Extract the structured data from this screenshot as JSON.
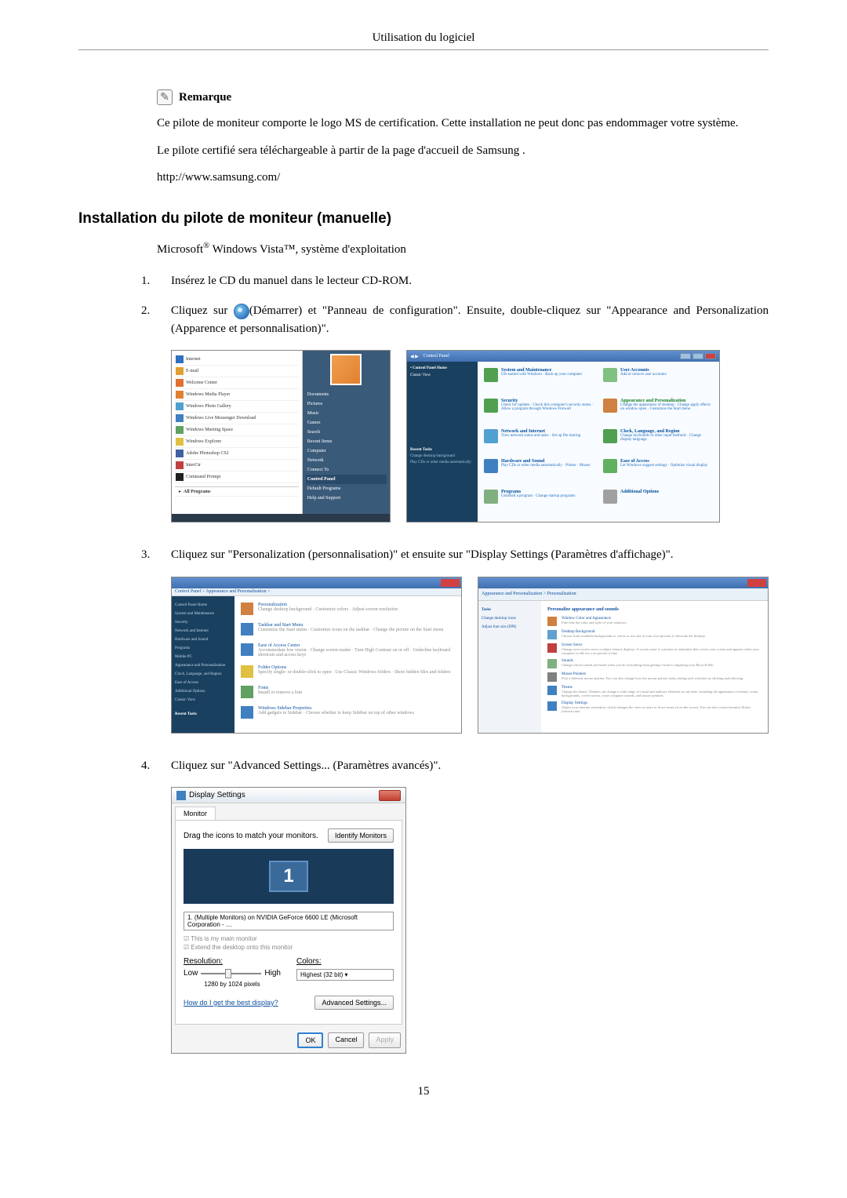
{
  "header": "Utilisation du logiciel",
  "note": {
    "title": "Remarque",
    "p1": "Ce pilote de moniteur comporte le logo MS de certification. Cette installation ne peut donc pas endommager votre système.",
    "p2": "Le pilote certifié sera téléchargeable à partir de la page d'accueil de Samsung .",
    "url": "http://www.samsung.com/"
  },
  "section_title": "Installation du pilote de moniteur (manuelle)",
  "subtitle_prefix": "Microsoft",
  "subtitle_mid": " Windows Vista™",
  "subtitle_suffix": ", système d'exploitation",
  "steps": {
    "1": "Insérez le CD du manuel dans le lecteur CD-ROM.",
    "2a": "Cliquez sur ",
    "2b": "(Démarrer) et \"Panneau de configuration\". Ensuite, double-cliquez sur \"Appearance and Personalization (Apparence et personnalisation)\".",
    "3": "Cliquez sur \"Personalization (personnalisation)\" et ensuite sur \"Display Settings (Paramètres d'affichage)\".",
    "4": "Cliquez sur \"Advanced Settings... (Paramètres avancés)\"."
  },
  "startmenu": {
    "items": [
      "Internet",
      "E-mail",
      "Welcome Center",
      "Windows Media Player",
      "Windows Photo Gallery",
      "Windows Live Messenger Download",
      "Windows Meeting Space",
      "Windows Explorer",
      "Adobe Photoshop CS2",
      "InterCtr",
      "Command Prompt",
      "All Programs"
    ],
    "right": [
      "Documents",
      "Pictures",
      "Music",
      "Games",
      "Search",
      "Recent Items",
      "Computer",
      "Network",
      "Connect To",
      "Control Panel",
      "Default Programs",
      "Help and Support"
    ]
  },
  "controlpanel": {
    "addr": "Control Panel",
    "sidebar": [
      "Control Panel Home",
      "Classic View"
    ],
    "recent": "Recent Tasks",
    "recent_items": [
      "Change desktop background",
      "Play CDs or other media automatically"
    ],
    "cats": [
      {
        "title": "System and Maintenance",
        "sub": "Get started with Windows · Back up your computer",
        "color": "#50a050"
      },
      {
        "title": "User Accounts",
        "sub": "Add or remove user accounts",
        "color": "#80c080"
      },
      {
        "title": "Security",
        "sub": "Check for updates · Check this computer's security status · Allow a program through Windows Firewall",
        "color": "#50a050"
      },
      {
        "title": "Appearance and Personalization",
        "sub": "Change the appearance of desktop · Change apply effects on window open · Customize the Start menu",
        "color": "#d08040",
        "hl": true
      },
      {
        "title": "Network and Internet",
        "sub": "View network status and tasks · Set up file sharing",
        "color": "#50a0d0"
      },
      {
        "title": "Clock, Language, and Region",
        "sub": "Change keyboards or other input methods · Change display language",
        "color": "#50a050"
      },
      {
        "title": "Hardware and Sound",
        "sub": "Play CDs or other media automatically · Printer · Mouse",
        "color": "#4080c0"
      },
      {
        "title": "Ease of Access",
        "sub": "Let Windows suggest settings · Optimize visual display",
        "color": "#60b060"
      },
      {
        "title": "Programs",
        "sub": "Uninstall a program · Change startup programs",
        "color": "#80b080"
      },
      {
        "title": "Additional Options",
        "sub": "",
        "color": "#a0a0a0"
      }
    ]
  },
  "personalization_left": {
    "addr": "Control Panel > Appearance and Personalization >",
    "sidebar": [
      "Control Panel Home",
      "System and Maintenance",
      "Security",
      "Network and Internet",
      "Hardware and Sound",
      "Programs",
      "Mobile PC",
      "Appearance and Personalization",
      "Clock, Language, and Region",
      "Ease of Access",
      "Additional Options",
      "Classic View"
    ],
    "recent": "Recent Tasks",
    "options": [
      {
        "title": "Personalization",
        "sub": "Change desktop background · Customize colors · Adjust screen resolution"
      },
      {
        "title": "Taskbar and Start Menu",
        "sub": "Customize the Start menu · Customize icons on the taskbar · Change the picture on the Start menu"
      },
      {
        "title": "Ease of Access Center",
        "sub": "Accommodate low vision · Change screen reader · Turn High Contrast on or off · Underline keyboard shortcuts and access keys"
      },
      {
        "title": "Folder Options",
        "sub": "Specify single- or double-click to open · Use Classic Windows folders · Show hidden files and folders"
      },
      {
        "title": "Fonts",
        "sub": "Install or remove a font"
      },
      {
        "title": "Windows Sidebar Properties",
        "sub": "Add gadgets to Sidebar · Choose whether to keep Sidebar on top of other windows"
      }
    ]
  },
  "personalization_right": {
    "addr": "Appearance and Personalization > Personalization",
    "header": "Personalize appearance and sounds",
    "sidebar": [
      "Tasks",
      "Change desktop icons",
      "Adjust font size (DPI)"
    ],
    "options": [
      {
        "title": "Window Color and Appearance",
        "sub": "Fine tune the color and style of your windows"
      },
      {
        "title": "Desktop Background",
        "sub": "Choose from available backgrounds or colors or use one of your own pictures to decorate the desktop"
      },
      {
        "title": "Screen Saver",
        "sub": "Change your screen saver or adjust when it displays. A screen saver is a picture or animation that covers your screen and appears when your computer is idle for a set period of time"
      },
      {
        "title": "Sounds",
        "sub": "Change which sounds are heard when you do everything from getting e-mail to emptying your Recycle Bin"
      },
      {
        "title": "Mouse Pointers",
        "sub": "Pick a different mouse pointer. You can also change how the mouse pointer looks during such activities as clicking and selecting"
      },
      {
        "title": "Theme",
        "sub": "Change the theme. Themes can change a wide range of visual and auditory elements at one time, including the appearance of menus, icons, backgrounds, screen savers, some computer sounds, and mouse pointers"
      },
      {
        "title": "Display Settings",
        "sub": "Adjust your monitor resolution, which changes the view so more or fewer items fit on the screen. You can also control monitor flicker (refresh rate)"
      }
    ]
  },
  "display_settings": {
    "title": "Display Settings",
    "tab": "Monitor",
    "instruction": "Drag the icons to match your monitors.",
    "identify": "Identify Monitors",
    "monitor_num": "1",
    "dropdown": "1. (Multiple Monitors) on NVIDIA GeForce 6600 LE (Microsoft Corporation - …",
    "cb1": "This is my main monitor",
    "cb2": "Extend the desktop onto this monitor",
    "res_label": "Resolution:",
    "res_low": "Low",
    "res_high": "High",
    "res_value": "1280 by 1024 pixels",
    "color_label": "Colors:",
    "color_value": "Highest (32 bit)",
    "help_link": "How do I get the best display?",
    "advanced": "Advanced Settings...",
    "ok": "OK",
    "cancel": "Cancel",
    "apply": "Apply"
  },
  "page_num": "15"
}
